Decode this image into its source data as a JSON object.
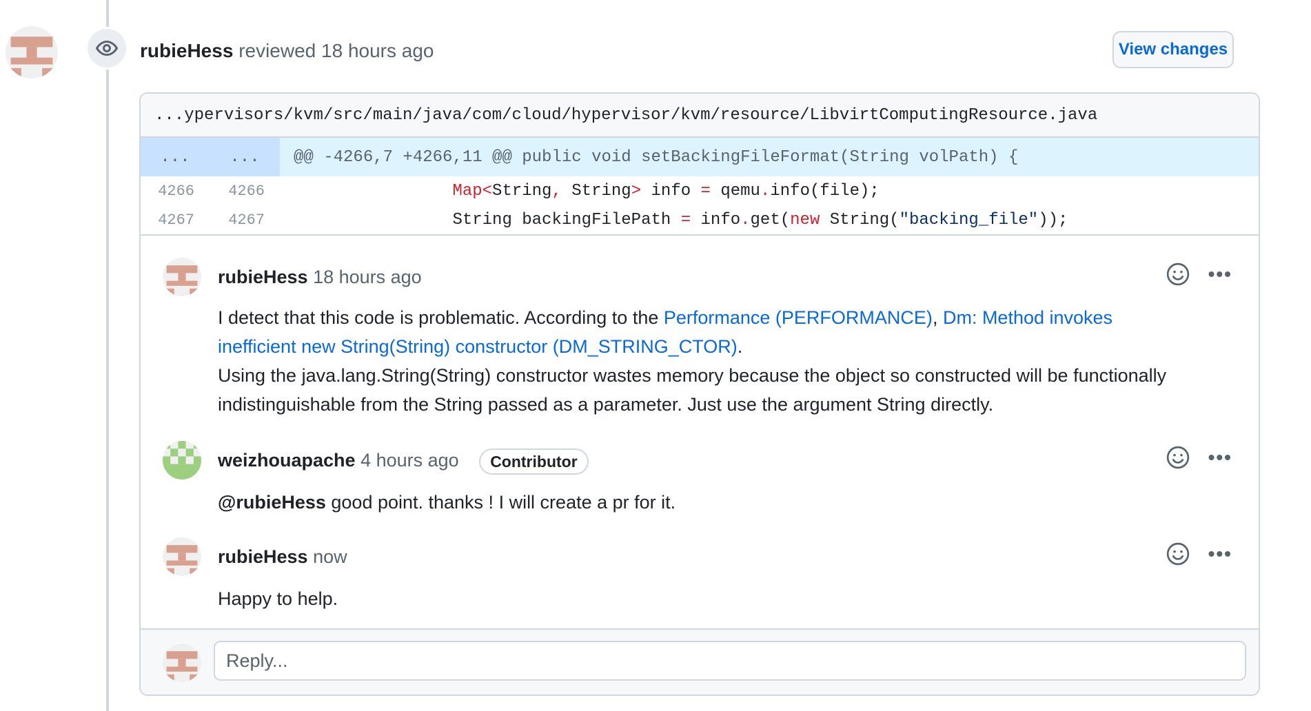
{
  "review": {
    "author": "rubieHess",
    "action": "reviewed",
    "time": "18 hours ago",
    "view_changes_label": "View changes"
  },
  "file": {
    "path": "...ypervisors/kvm/src/main/java/com/cloud/hypervisor/kvm/resource/LibvirtComputingResource.java"
  },
  "diff": {
    "hunk_left": "...",
    "hunk_right": "...",
    "hunk_header": "@@ -4266,7 +4266,11 @@ public void setBackingFileFormat(String volPath) {",
    "lines": [
      {
        "old": "4266",
        "new": "4266"
      },
      {
        "old": "4267",
        "new": "4267"
      }
    ]
  },
  "comments": [
    {
      "author": "rubieHess",
      "time": "18 hours ago",
      "body_intro": "I detect that this code is problematic. According to the ",
      "link1": "Performance (PERFORMANCE)",
      "sep": ", ",
      "link2": "Dm: Method invokes inefficient new String(String) constructor (DM_STRING_CTOR)",
      "period": ".",
      "body_rest": "Using the java.lang.String(String) constructor wastes memory because the object so constructed will be functionally indistinguishable from the String passed as a parameter.  Just use the argument String directly."
    },
    {
      "author": "weizhouapache",
      "time": "4 hours ago",
      "badge": "Contributor",
      "mention": "@rubieHess",
      "body": " good point. thanks ! I will create a pr for it."
    },
    {
      "author": "rubieHess",
      "time": "now",
      "body": "Happy to help."
    }
  ],
  "reply": {
    "placeholder": "Reply..."
  },
  "icons": {
    "review": "eye-icon",
    "reaction": "smiley-icon",
    "more": "kebab-horizontal-icon"
  },
  "colors": {
    "link": "#0969da",
    "hunk_bg": "#ddf4ff",
    "keyword_red": "#cf222e",
    "avatar_brown": "#d8a08f",
    "avatar_green": "#9ccf7f"
  }
}
